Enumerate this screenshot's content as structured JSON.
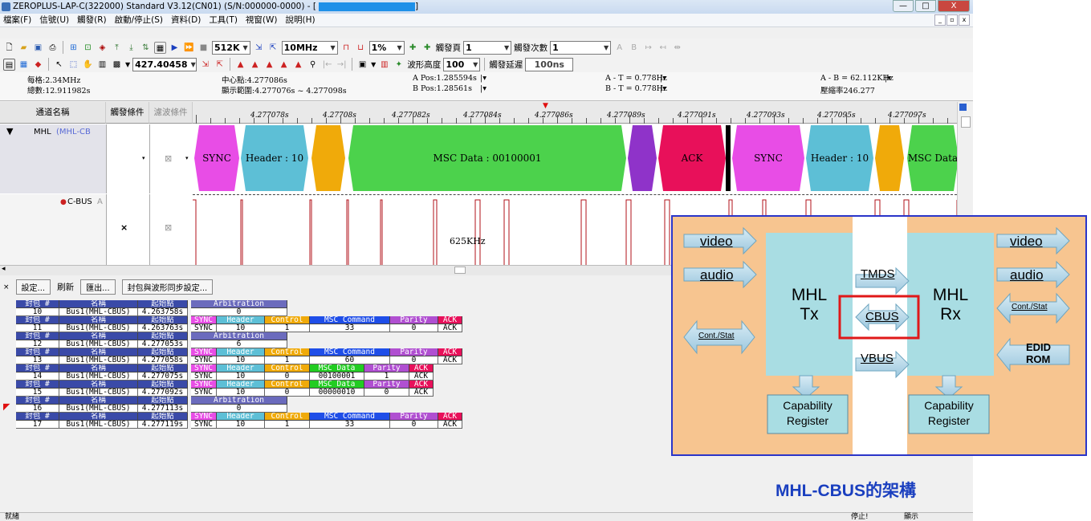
{
  "window": {
    "title": "ZEROPLUS-LAP-C(322000) Standard V3.12(CN01) (S/N:000000-0000) - [",
    "title_end": "]",
    "controls": [
      "—",
      "□",
      "X"
    ]
  },
  "menu": [
    "檔案(F)",
    "信號(U)",
    "觸發(R)",
    "啟動/停止(S)",
    "資料(D)",
    "工具(T)",
    "視窗(W)",
    "說明(H)"
  ],
  "toolbar1": {
    "memory": "512K",
    "frequency": "10MHz",
    "percent": "1%",
    "trigger_page_label": "觸發頁",
    "trigger_page": "1",
    "trigger_count_label": "觸發次數",
    "trigger_count": "1"
  },
  "toolbar2": {
    "position": "427.40458",
    "wave_height_label": "波形高度",
    "wave_height": "100",
    "trigger_delay_label": "觸發延遲",
    "trigger_delay": "100ns"
  },
  "info": {
    "per_div": "每格:2.34MHz",
    "total": "總數:12.911982s",
    "center": "中心點:4.277086s",
    "display_range": "顯示範圍:4.277076s ~ 4.277098s",
    "a_pos": "A Pos:1.285594s",
    "b_pos": "B Pos:1.28561s",
    "a_t": "A - T = 0.778Hz",
    "b_t": "B - T = 0.778Hz",
    "a_b": "A - B = 62.112KHz",
    "compress": "壓縮率246.277"
  },
  "columns": {
    "channel_name": "通道名稱",
    "trigger_cond": "觸發條件",
    "filter_cond": "濾波條件"
  },
  "channels": [
    {
      "name": "MHL",
      "sub": "(MHL-CB"
    },
    {
      "name": "C-BUS",
      "sub": "A"
    }
  ],
  "ruler": [
    "4.277078s",
    "4.27708s",
    "4.277082s",
    "4.277084s",
    "4.277086s",
    "4.277089s",
    "4.277091s",
    "4.277093s",
    "4.277095s",
    "4.277097s"
  ],
  "segments": [
    {
      "label": "SYNC",
      "color": "#e84de6"
    },
    {
      "label": "Header : 10",
      "color": "#5dbfd6"
    },
    {
      "label": "",
      "color": "#f0aa0a"
    },
    {
      "label": "MSC Data : 00100001",
      "color": "#4cd24c"
    },
    {
      "label": "",
      "color": "#8f33c9"
    },
    {
      "label": "ACK",
      "color": "#e8105a"
    },
    {
      "label": "SYNC",
      "color": "#e84de6"
    },
    {
      "label": "Header : 10",
      "color": "#5dbfd6"
    },
    {
      "label": "",
      "color": "#f0aa0a"
    },
    {
      "label": "MSC Data",
      "color": "#4cd24c"
    }
  ],
  "frequency_label": "625KHz",
  "actions": {
    "settings": "設定...",
    "refresh": "刷新",
    "export": "匯出...",
    "sync": "封包與波形同步設定..."
  },
  "packet_headers": {
    "num": "封包 #",
    "name": "名稱",
    "start": "起始點"
  },
  "packets": [
    {
      "num": "10",
      "name": "Bus1(MHL-CBUS)",
      "start": "4.263758s",
      "fields": [
        {
          "h": "Arbitration",
          "c": "#6b6bbd",
          "v": "0",
          "w": 120
        }
      ]
    },
    {
      "num": "11",
      "name": "Bus1(MHL-CBUS)",
      "start": "4.263763s",
      "fields": [
        {
          "h": "SYNC",
          "c": "#e84de6",
          "v": "SYNC",
          "w": 32
        },
        {
          "h": "Header",
          "c": "#5dbfd6",
          "v": "10",
          "w": 60
        },
        {
          "h": "Control",
          "c": "#f0aa0a",
          "v": "1",
          "w": 56
        },
        {
          "h": "MSC Command",
          "c": "#1f4ee8",
          "v": "33",
          "w": 100
        },
        {
          "h": "Parity",
          "c": "#b04fd1",
          "v": "0",
          "w": 60
        },
        {
          "h": "ACK",
          "c": "#e8105a",
          "v": "ACK",
          "w": 30
        }
      ]
    },
    {
      "num": "12",
      "name": "Bus1(MHL-CBUS)",
      "start": "4.277053s",
      "fields": [
        {
          "h": "Arbitration",
          "c": "#6b6bbd",
          "v": "6",
          "w": 120
        }
      ]
    },
    {
      "num": "13",
      "name": "Bus1(MHL-CBUS)",
      "start": "4.277058s",
      "fields": [
        {
          "h": "SYNC",
          "c": "#e84de6",
          "v": "SYNC",
          "w": 32
        },
        {
          "h": "Header",
          "c": "#5dbfd6",
          "v": "10",
          "w": 60
        },
        {
          "h": "Control",
          "c": "#f0aa0a",
          "v": "1",
          "w": 56
        },
        {
          "h": "MSC Command",
          "c": "#1f4ee8",
          "v": "60",
          "w": 100
        },
        {
          "h": "Parity",
          "c": "#b04fd1",
          "v": "0",
          "w": 60
        },
        {
          "h": "ACK",
          "c": "#e8105a",
          "v": "ACK",
          "w": 30
        }
      ]
    },
    {
      "num": "14",
      "name": "Bus1(MHL-CBUS)",
      "start": "4.277075s",
      "fields": [
        {
          "h": "SYNC",
          "c": "#e84de6",
          "v": "SYNC",
          "w": 32
        },
        {
          "h": "Header",
          "c": "#5dbfd6",
          "v": "10",
          "w": 60
        },
        {
          "h": "Control",
          "c": "#f0aa0a",
          "v": "0",
          "w": 56
        },
        {
          "h": "MSC Data",
          "c": "#22cc22",
          "v": "00100001",
          "w": 68
        },
        {
          "h": "Parity",
          "c": "#b04fd1",
          "v": "1",
          "w": 56
        },
        {
          "h": "ACK",
          "c": "#e8105a",
          "v": "ACK",
          "w": 30
        }
      ]
    },
    {
      "num": "15",
      "name": "Bus1(MHL-CBUS)",
      "start": "4.277092s",
      "fields": [
        {
          "h": "SYNC",
          "c": "#e84de6",
          "v": "SYNC",
          "w": 32
        },
        {
          "h": "Header",
          "c": "#5dbfd6",
          "v": "10",
          "w": 60
        },
        {
          "h": "Control",
          "c": "#f0aa0a",
          "v": "0",
          "w": 56
        },
        {
          "h": "MSC Data",
          "c": "#22cc22",
          "v": "00000010",
          "w": 68
        },
        {
          "h": "Parity",
          "c": "#b04fd1",
          "v": "0",
          "w": 56
        },
        {
          "h": "ACK",
          "c": "#e8105a",
          "v": "ACK",
          "w": 30
        }
      ]
    },
    {
      "num": "16",
      "name": "Bus1(MHL-CBUS)",
      "start": "4.277113s",
      "fields": [
        {
          "h": "Arbitration",
          "c": "#6b6bbd",
          "v": "0",
          "w": 120
        }
      ]
    },
    {
      "num": "17",
      "name": "Bus1(MHL-CBUS)",
      "start": "4.277119s",
      "fields": [
        {
          "h": "SYNC",
          "c": "#e84de6",
          "v": "SYNC",
          "w": 32
        },
        {
          "h": "Header",
          "c": "#5dbfd6",
          "v": "10",
          "w": 60
        },
        {
          "h": "Control",
          "c": "#f0aa0a",
          "v": "1",
          "w": 56
        },
        {
          "h": "MSC Command",
          "c": "#1f4ee8",
          "v": "33",
          "w": 100
        },
        {
          "h": "Parity",
          "c": "#b04fd1",
          "v": "0",
          "w": 60
        },
        {
          "h": "ACK",
          "c": "#e8105a",
          "v": "ACK",
          "w": 30
        }
      ]
    }
  ],
  "status": {
    "left": "就緒",
    "stop": "停止!",
    "show": "顯示"
  },
  "diagram": {
    "in_video": "video",
    "in_audio": "audio",
    "in_cont": "Cont./Stat",
    "tx": [
      "MHL",
      "Tx"
    ],
    "rx": [
      "MHL",
      "Rx"
    ],
    "tmds": "TMDS",
    "cbus": "CBUS",
    "vbus": "VBUS",
    "out_video": "video",
    "out_audio": "audio",
    "out_cont": "Cont./Stat",
    "edid": [
      "EDID",
      "ROM"
    ],
    "cap_left": [
      "Capability",
      "Register"
    ],
    "cap_right": [
      "Capability",
      "Register"
    ]
  },
  "caption": "MHL-CBUS的架構"
}
